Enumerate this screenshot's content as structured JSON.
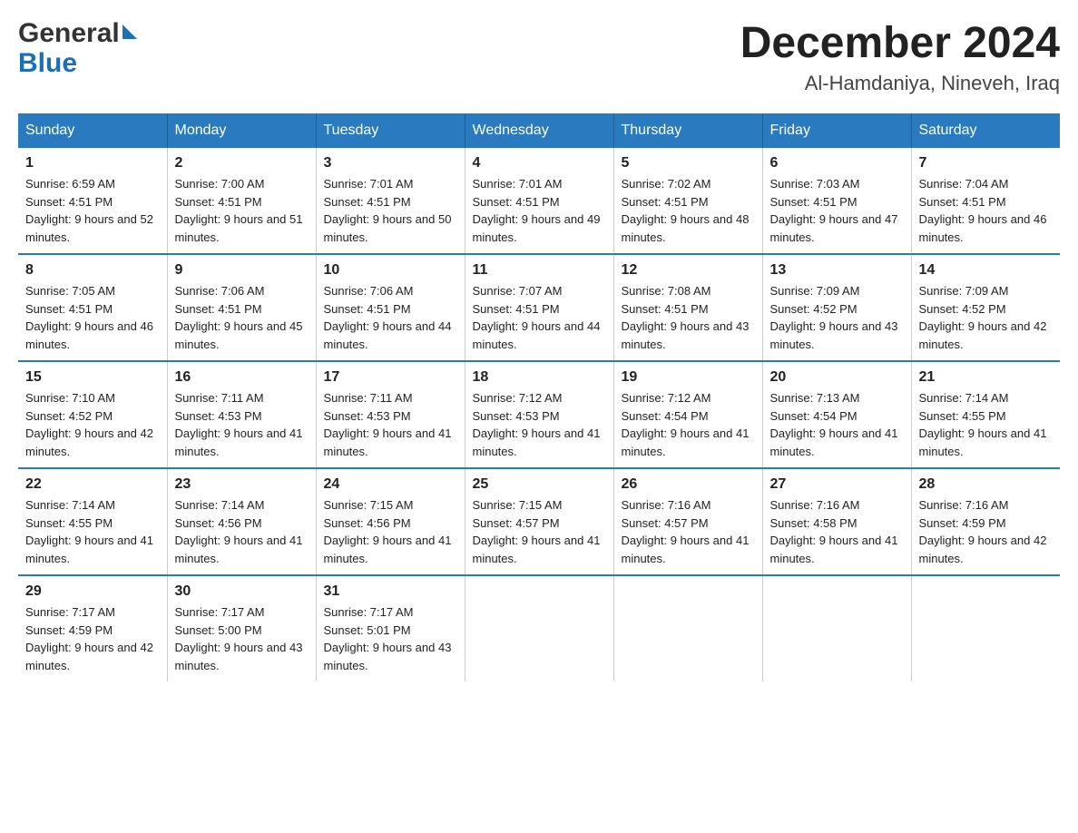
{
  "header": {
    "logo_general": "General",
    "logo_blue": "Blue",
    "title": "December 2024",
    "subtitle": "Al-Hamdaniya, Nineveh, Iraq"
  },
  "calendar": {
    "days_of_week": [
      "Sunday",
      "Monday",
      "Tuesday",
      "Wednesday",
      "Thursday",
      "Friday",
      "Saturday"
    ],
    "weeks": [
      [
        {
          "day": "1",
          "sunrise": "6:59 AM",
          "sunset": "4:51 PM",
          "daylight": "9 hours and 52 minutes."
        },
        {
          "day": "2",
          "sunrise": "7:00 AM",
          "sunset": "4:51 PM",
          "daylight": "9 hours and 51 minutes."
        },
        {
          "day": "3",
          "sunrise": "7:01 AM",
          "sunset": "4:51 PM",
          "daylight": "9 hours and 50 minutes."
        },
        {
          "day": "4",
          "sunrise": "7:01 AM",
          "sunset": "4:51 PM",
          "daylight": "9 hours and 49 minutes."
        },
        {
          "day": "5",
          "sunrise": "7:02 AM",
          "sunset": "4:51 PM",
          "daylight": "9 hours and 48 minutes."
        },
        {
          "day": "6",
          "sunrise": "7:03 AM",
          "sunset": "4:51 PM",
          "daylight": "9 hours and 47 minutes."
        },
        {
          "day": "7",
          "sunrise": "7:04 AM",
          "sunset": "4:51 PM",
          "daylight": "9 hours and 46 minutes."
        }
      ],
      [
        {
          "day": "8",
          "sunrise": "7:05 AM",
          "sunset": "4:51 PM",
          "daylight": "9 hours and 46 minutes."
        },
        {
          "day": "9",
          "sunrise": "7:06 AM",
          "sunset": "4:51 PM",
          "daylight": "9 hours and 45 minutes."
        },
        {
          "day": "10",
          "sunrise": "7:06 AM",
          "sunset": "4:51 PM",
          "daylight": "9 hours and 44 minutes."
        },
        {
          "day": "11",
          "sunrise": "7:07 AM",
          "sunset": "4:51 PM",
          "daylight": "9 hours and 44 minutes."
        },
        {
          "day": "12",
          "sunrise": "7:08 AM",
          "sunset": "4:51 PM",
          "daylight": "9 hours and 43 minutes."
        },
        {
          "day": "13",
          "sunrise": "7:09 AM",
          "sunset": "4:52 PM",
          "daylight": "9 hours and 43 minutes."
        },
        {
          "day": "14",
          "sunrise": "7:09 AM",
          "sunset": "4:52 PM",
          "daylight": "9 hours and 42 minutes."
        }
      ],
      [
        {
          "day": "15",
          "sunrise": "7:10 AM",
          "sunset": "4:52 PM",
          "daylight": "9 hours and 42 minutes."
        },
        {
          "day": "16",
          "sunrise": "7:11 AM",
          "sunset": "4:53 PM",
          "daylight": "9 hours and 41 minutes."
        },
        {
          "day": "17",
          "sunrise": "7:11 AM",
          "sunset": "4:53 PM",
          "daylight": "9 hours and 41 minutes."
        },
        {
          "day": "18",
          "sunrise": "7:12 AM",
          "sunset": "4:53 PM",
          "daylight": "9 hours and 41 minutes."
        },
        {
          "day": "19",
          "sunrise": "7:12 AM",
          "sunset": "4:54 PM",
          "daylight": "9 hours and 41 minutes."
        },
        {
          "day": "20",
          "sunrise": "7:13 AM",
          "sunset": "4:54 PM",
          "daylight": "9 hours and 41 minutes."
        },
        {
          "day": "21",
          "sunrise": "7:14 AM",
          "sunset": "4:55 PM",
          "daylight": "9 hours and 41 minutes."
        }
      ],
      [
        {
          "day": "22",
          "sunrise": "7:14 AM",
          "sunset": "4:55 PM",
          "daylight": "9 hours and 41 minutes."
        },
        {
          "day": "23",
          "sunrise": "7:14 AM",
          "sunset": "4:56 PM",
          "daylight": "9 hours and 41 minutes."
        },
        {
          "day": "24",
          "sunrise": "7:15 AM",
          "sunset": "4:56 PM",
          "daylight": "9 hours and 41 minutes."
        },
        {
          "day": "25",
          "sunrise": "7:15 AM",
          "sunset": "4:57 PM",
          "daylight": "9 hours and 41 minutes."
        },
        {
          "day": "26",
          "sunrise": "7:16 AM",
          "sunset": "4:57 PM",
          "daylight": "9 hours and 41 minutes."
        },
        {
          "day": "27",
          "sunrise": "7:16 AM",
          "sunset": "4:58 PM",
          "daylight": "9 hours and 41 minutes."
        },
        {
          "day": "28",
          "sunrise": "7:16 AM",
          "sunset": "4:59 PM",
          "daylight": "9 hours and 42 minutes."
        }
      ],
      [
        {
          "day": "29",
          "sunrise": "7:17 AM",
          "sunset": "4:59 PM",
          "daylight": "9 hours and 42 minutes."
        },
        {
          "day": "30",
          "sunrise": "7:17 AM",
          "sunset": "5:00 PM",
          "daylight": "9 hours and 43 minutes."
        },
        {
          "day": "31",
          "sunrise": "7:17 AM",
          "sunset": "5:01 PM",
          "daylight": "9 hours and 43 minutes."
        },
        null,
        null,
        null,
        null
      ]
    ]
  }
}
